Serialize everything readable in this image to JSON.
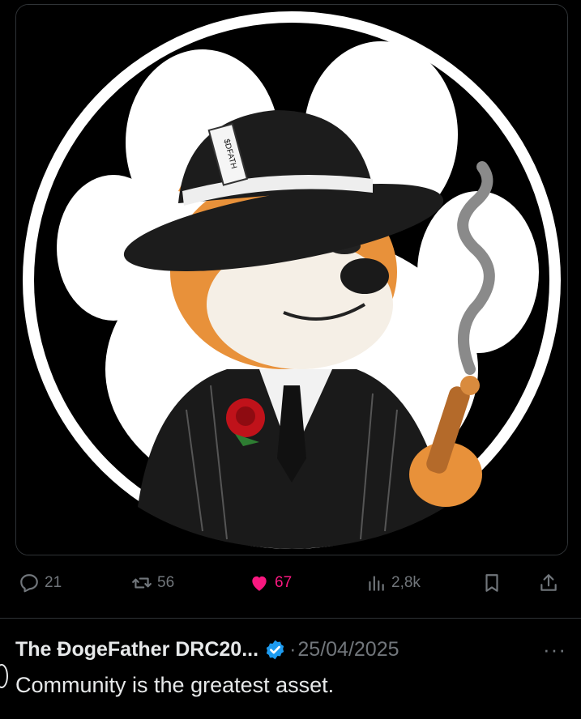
{
  "media": {
    "description_icon": "dogefather-avatar",
    "ticket_text": "$DFATH"
  },
  "actions": {
    "replies": "21",
    "reposts": "56",
    "likes": "67",
    "views": "2,8k",
    "like_color": "#f91880",
    "muted_color": "#71767b"
  },
  "post": {
    "author": "The ĐogeFather DRC20...",
    "separator": "·",
    "date": "25/04/2025",
    "more": "···",
    "text": "Community is the greatest asset.",
    "verified_color": "#1d9bf0"
  }
}
